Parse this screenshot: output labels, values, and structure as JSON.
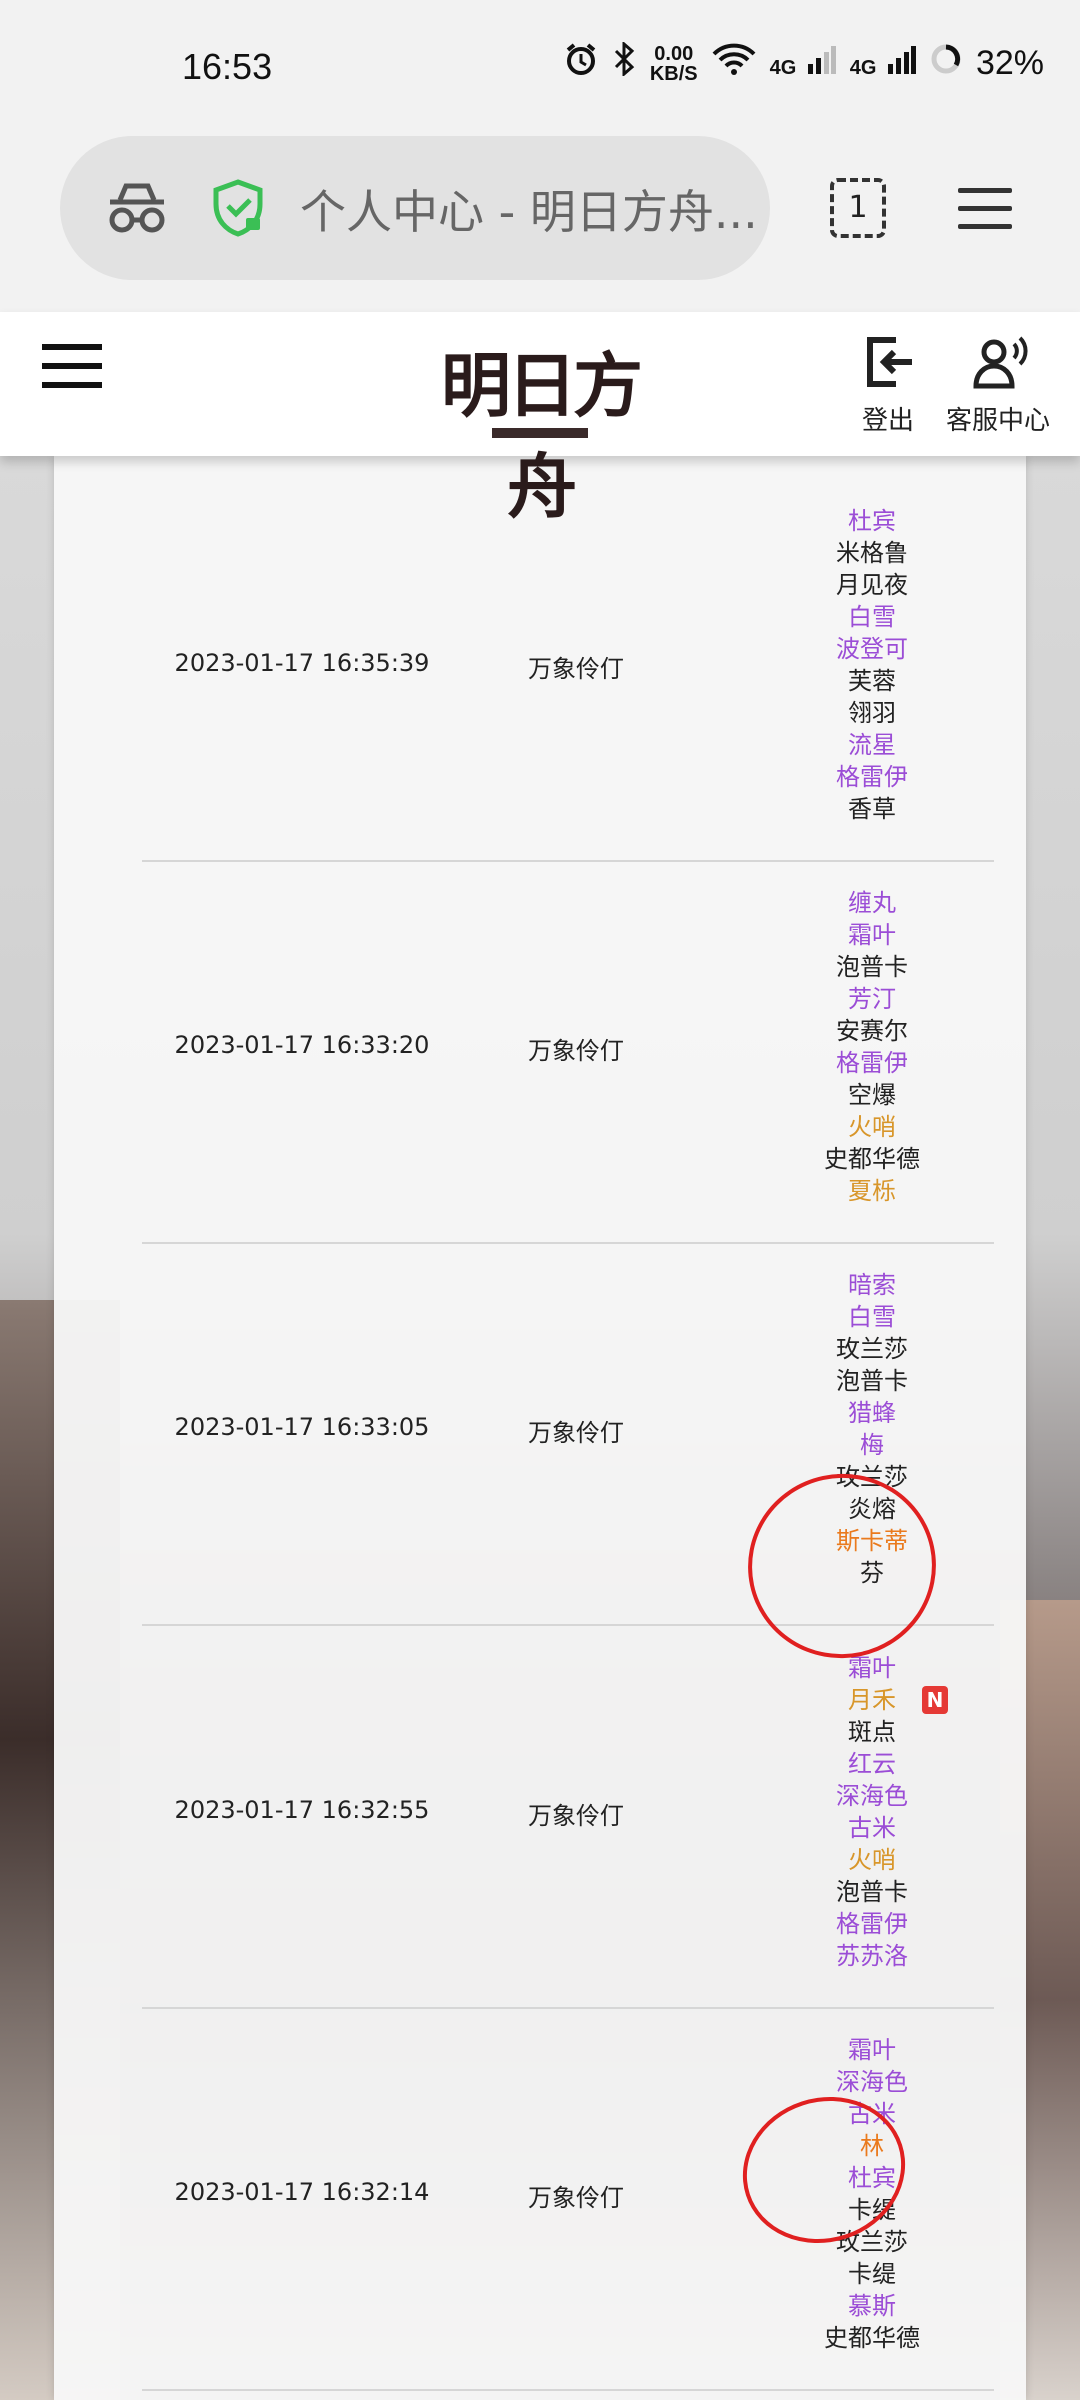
{
  "status_bar": {
    "time": "16:53",
    "net_speed_top": "0.00",
    "net_speed_bottom": "KB/S",
    "signal1": "4G",
    "signal2": "4G",
    "battery": "32%"
  },
  "browser": {
    "url_title": "个人中心 - 明日方舟...",
    "tab_count": "1"
  },
  "header": {
    "logo_text": "明日方舟",
    "logout_label": "登出",
    "support_label": "客服中心"
  },
  "colors": {
    "rarity3": "#222222",
    "rarity4": "#9b4dd6",
    "rarity5": "#d8962a",
    "rarity6": "#ea7a1d",
    "annotation": "#e02020"
  },
  "records": [
    {
      "time": "2023-01-17 16:35:39",
      "pool": "万象伶仃",
      "operators": [
        {
          "name": "杜宾",
          "rarity": 4
        },
        {
          "name": "米格鲁",
          "rarity": 3
        },
        {
          "name": "月见夜",
          "rarity": 3
        },
        {
          "name": "白雪",
          "rarity": 4
        },
        {
          "name": "波登可",
          "rarity": 4
        },
        {
          "name": "芙蓉",
          "rarity": 3
        },
        {
          "name": "翎羽",
          "rarity": 3
        },
        {
          "name": "流星",
          "rarity": 4
        },
        {
          "name": "格雷伊",
          "rarity": 4
        },
        {
          "name": "香草",
          "rarity": 3
        }
      ]
    },
    {
      "time": "2023-01-17 16:33:20",
      "pool": "万象伶仃",
      "operators": [
        {
          "name": "缠丸",
          "rarity": 4
        },
        {
          "name": "霜叶",
          "rarity": 4
        },
        {
          "name": "泡普卡",
          "rarity": 3
        },
        {
          "name": "芳汀",
          "rarity": 4
        },
        {
          "name": "安赛尔",
          "rarity": 3
        },
        {
          "name": "格雷伊",
          "rarity": 4
        },
        {
          "name": "空爆",
          "rarity": 3
        },
        {
          "name": "火哨",
          "rarity": 5
        },
        {
          "name": "史都华德",
          "rarity": 3
        },
        {
          "name": "夏栎",
          "rarity": 5
        }
      ]
    },
    {
      "time": "2023-01-17 16:33:05",
      "pool": "万象伶仃",
      "operators": [
        {
          "name": "暗索",
          "rarity": 4
        },
        {
          "name": "白雪",
          "rarity": 4
        },
        {
          "name": "玫兰莎",
          "rarity": 3
        },
        {
          "name": "泡普卡",
          "rarity": 3
        },
        {
          "name": "猎蜂",
          "rarity": 4
        },
        {
          "name": "梅",
          "rarity": 4
        },
        {
          "name": "玫兰莎",
          "rarity": 3
        },
        {
          "name": "炎熔",
          "rarity": 3
        },
        {
          "name": "斯卡蒂",
          "rarity": 6
        },
        {
          "name": "芬",
          "rarity": 3
        }
      ]
    },
    {
      "time": "2023-01-17 16:32:55",
      "pool": "万象伶仃",
      "operators": [
        {
          "name": "霜叶",
          "rarity": 4
        },
        {
          "name": "月禾",
          "rarity": 5,
          "new": "N"
        },
        {
          "name": "斑点",
          "rarity": 3
        },
        {
          "name": "红云",
          "rarity": 4
        },
        {
          "name": "深海色",
          "rarity": 4
        },
        {
          "name": "古米",
          "rarity": 4
        },
        {
          "name": "火哨",
          "rarity": 5
        },
        {
          "name": "泡普卡",
          "rarity": 3
        },
        {
          "name": "格雷伊",
          "rarity": 4
        },
        {
          "name": "苏苏洛",
          "rarity": 4
        }
      ]
    },
    {
      "time": "2023-01-17 16:32:14",
      "pool": "万象伶仃",
      "operators": [
        {
          "name": "霜叶",
          "rarity": 4
        },
        {
          "name": "深海色",
          "rarity": 4
        },
        {
          "name": "古米",
          "rarity": 4
        },
        {
          "name": "林",
          "rarity": 6
        },
        {
          "name": "杜宾",
          "rarity": 4
        },
        {
          "name": "卡缇",
          "rarity": 3
        },
        {
          "name": "玫兰莎",
          "rarity": 3
        },
        {
          "name": "卡缇",
          "rarity": 3
        },
        {
          "name": "慕斯",
          "rarity": 4
        },
        {
          "name": "史都华德",
          "rarity": 3
        }
      ]
    }
  ]
}
